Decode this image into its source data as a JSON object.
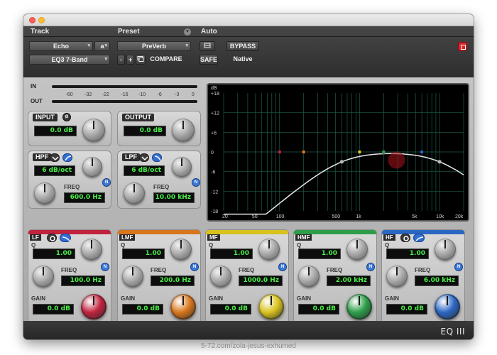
{
  "header": {
    "track_label": "Track",
    "preset_label": "Preset",
    "auto_label": "Auto",
    "track_name": "Echo",
    "track_channel": "a",
    "plugin_name": "EQ3 7-Band",
    "preset_name": "PreVerb",
    "compare_label": "COMPARE",
    "minus_label": "-",
    "plus_label": "+",
    "bypass_label": "BYPASS",
    "safe_label": "SAFE",
    "native_label": "Native"
  },
  "meters": {
    "in_label": "IN",
    "out_label": "OUT",
    "scale": [
      "-60",
      "-32",
      "-22",
      "-16",
      "-10",
      "-6",
      "-3",
      "0"
    ]
  },
  "input": {
    "label": "INPUT",
    "value": "0.0 dB"
  },
  "output": {
    "label": "OUTPUT",
    "value": "0.0 dB"
  },
  "hpf": {
    "label": "HPF",
    "slope": "6 dB/oct",
    "freq_label": "FREQ",
    "freq": "600.0 Hz"
  },
  "lpf": {
    "label": "LPF",
    "slope": "6 dB/oct",
    "freq_label": "FREQ",
    "freq": "10.00 kHz"
  },
  "graph": {
    "y_labels": [
      "dB",
      "+18",
      "+12",
      "+6",
      "0",
      "-6",
      "-12",
      "-18"
    ],
    "x_labels": [
      "20",
      "50",
      "100",
      "500",
      "1k",
      "5k",
      "10k",
      "20k"
    ]
  },
  "bands": [
    {
      "name": "LF",
      "q_label": "Q",
      "q": "1.00",
      "freq_label": "FREQ",
      "freq": "100.0 Hz",
      "gain_label": "GAIN",
      "gain": "0.0 dB",
      "color": "#c0233e"
    },
    {
      "name": "LMF",
      "q_label": "Q",
      "q": "1.00",
      "freq_label": "FREQ",
      "freq": "200.0 Hz",
      "gain_label": "GAIN",
      "gain": "0.0 dB",
      "color": "#d7761c"
    },
    {
      "name": "MF",
      "q_label": "Q",
      "q": "1.00",
      "freq_label": "FREQ",
      "freq": "1000.0 Hz",
      "gain_label": "GAIN",
      "gain": "0.0 dB",
      "color": "#d8c21e"
    },
    {
      "name": "HMF",
      "q_label": "Q",
      "q": "1.00",
      "freq_label": "FREQ",
      "freq": "2.00 kHz",
      "gain_label": "GAIN",
      "gain": "0.0 dB",
      "color": "#2d9d4a"
    },
    {
      "name": "HF",
      "q_label": "Q",
      "q": "1.00",
      "freq_label": "FREQ",
      "freq": "6.00 kHz",
      "gain_label": "GAIN",
      "gain": "0.0 dB",
      "color": "#2b66c2"
    }
  ],
  "n_label": "N",
  "brand": "EQ III",
  "watermark": "5-72.com/zola-jesus-exhumed"
}
